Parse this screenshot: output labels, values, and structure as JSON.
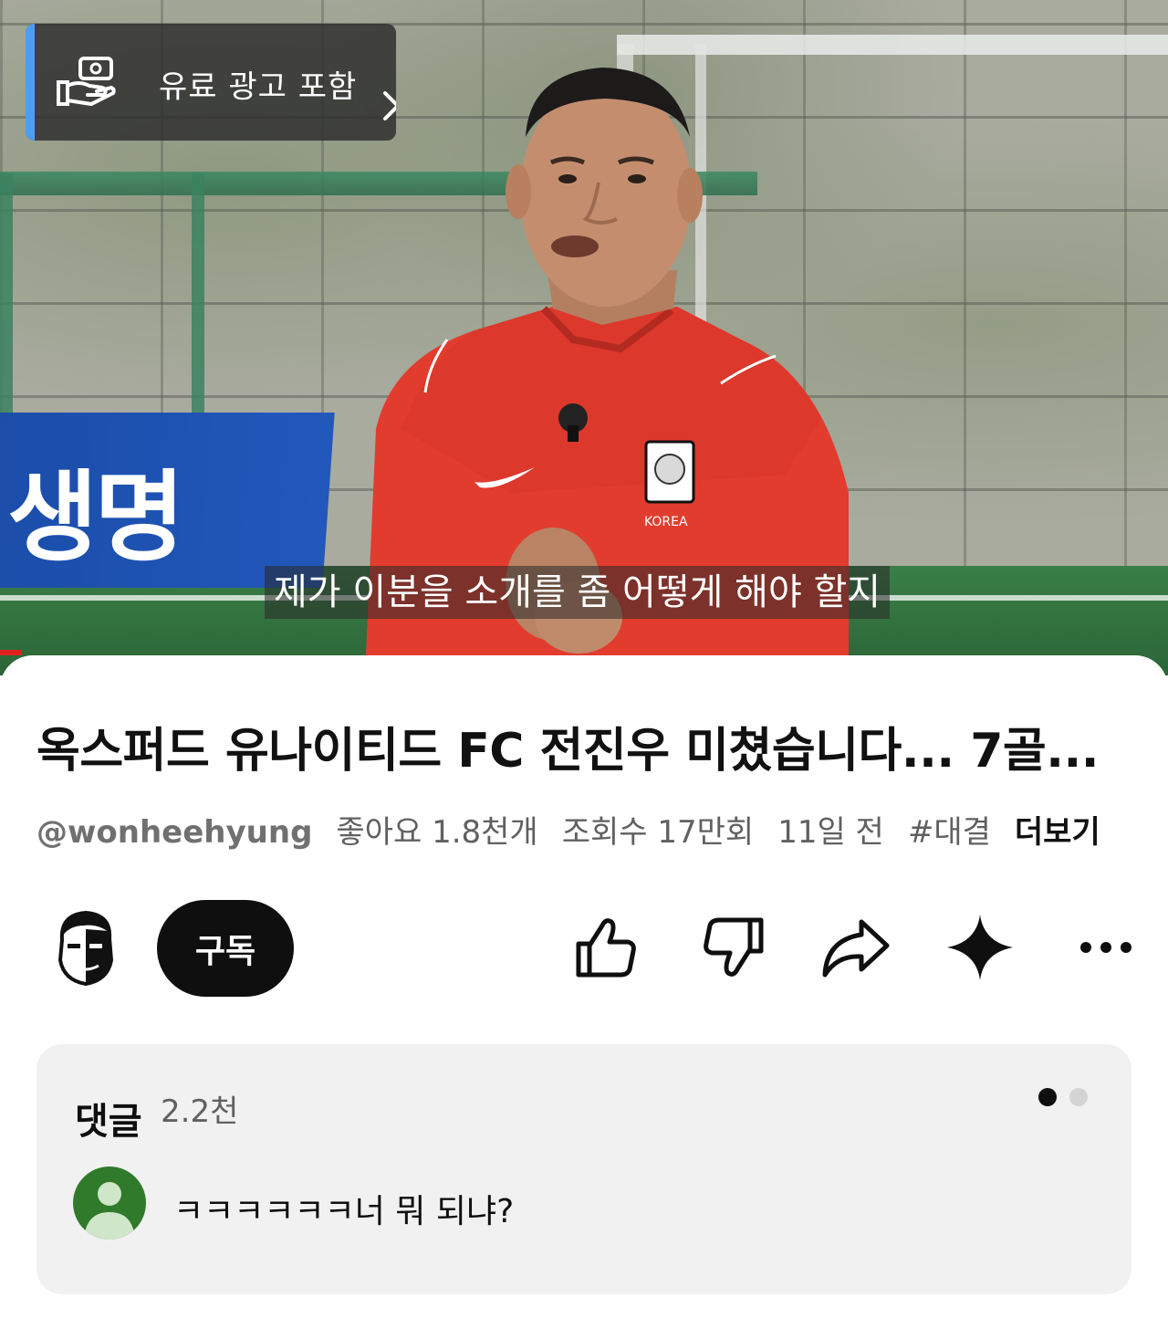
{
  "video": {
    "ad_label": "유료 광고 포함",
    "subtitle": "제가 이분을 소개를 좀 어떻게 해야 할지",
    "banner_text": "생명",
    "accent_color": "#4a9ff5",
    "progress_color": "#e02020"
  },
  "info": {
    "title": "옥스퍼드 유나이티드 FC 전진우 미쳤습니다... 7골...",
    "handle": "@wonheehyung",
    "likes": "좋아요 1.8천개",
    "views": "조회수 17만회",
    "age": "11일 전",
    "hashtag": "#대결",
    "more": "더보기"
  },
  "actions": {
    "subscribe_label": "구독",
    "icons": [
      "like-icon",
      "dislike-icon",
      "share-icon",
      "ask-sparkle-icon",
      "more-icon"
    ]
  },
  "comments": {
    "title": "댓글",
    "count": "2.2천",
    "top_comment": "ㅋㅋㅋㅋㅋㅋ너 뭐 되냐?"
  }
}
